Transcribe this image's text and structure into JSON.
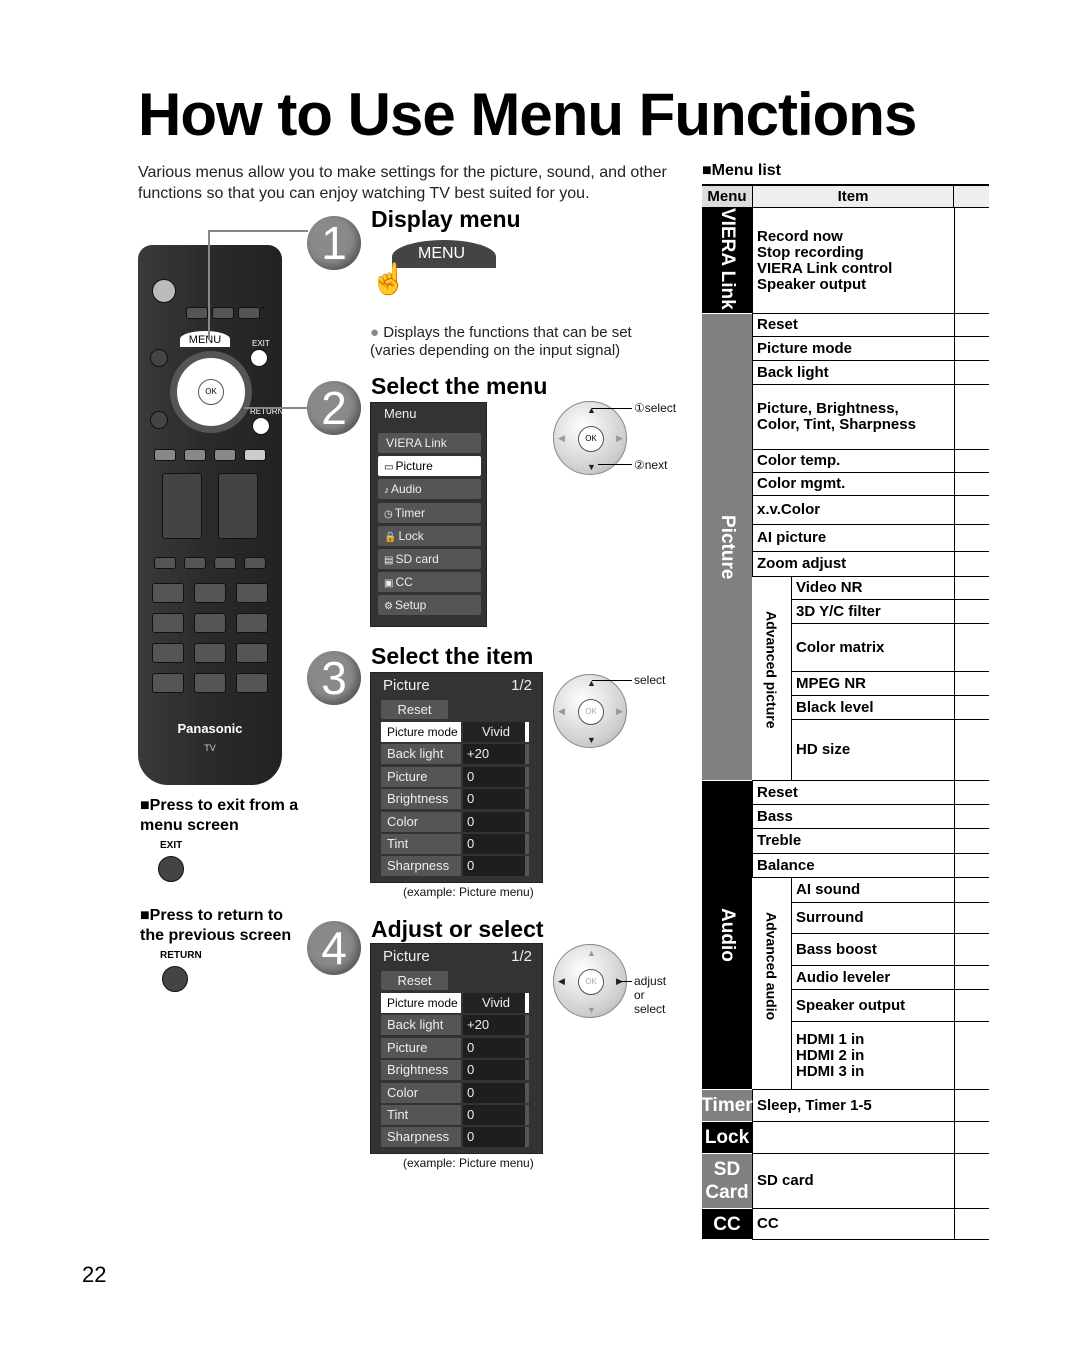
{
  "title": "How to Use Menu Functions",
  "intro": "Various menus allow you to make settings for the picture, sound, and other functions so that you can enjoy watching TV best suited for you.",
  "steps": [
    {
      "num": "1",
      "heading": "Display menu",
      "button_label": "MENU",
      "note": "Displays the functions that can be set (varies depending on the input signal)"
    },
    {
      "num": "2",
      "heading": "Select the menu",
      "dial_labels": [
        "①select",
        "②next"
      ]
    },
    {
      "num": "3",
      "heading": "Select the item",
      "dial_labels": [
        "select"
      ],
      "caption": "(example:  Picture menu)"
    },
    {
      "num": "4",
      "heading": "Adjust or select",
      "dial_labels": [
        "adjust",
        "or",
        "select"
      ],
      "caption": "(example:  Picture menu)"
    }
  ],
  "remote": {
    "menu": "MENU",
    "exit": "EXIT",
    "ok": "OK",
    "return": "RETURN",
    "brand": "Panasonic",
    "tv": "TV"
  },
  "side_notes": [
    {
      "text": "Press to exit from a menu screen",
      "button": "EXIT"
    },
    {
      "text": "Press to return to the previous screen",
      "button": "RETURN"
    }
  ],
  "menu_screen": {
    "title": "Menu",
    "items": [
      {
        "label": "VIERA Link",
        "icon": ""
      },
      {
        "label": "Picture",
        "icon": "▭",
        "selected": true
      },
      {
        "label": "Audio",
        "icon": "♪"
      },
      {
        "label": "Timer",
        "icon": "◷"
      },
      {
        "label": "Lock",
        "icon": "🔒"
      },
      {
        "label": "SD card",
        "icon": "▤"
      },
      {
        "label": "CC",
        "icon": "▣"
      },
      {
        "label": "Setup",
        "icon": "⚙"
      }
    ]
  },
  "picture_screen": {
    "title": "Picture",
    "page": "1/2",
    "reset": "Reset",
    "rows": [
      {
        "label": "Picture mode",
        "value": "Vivid",
        "selected": true
      },
      {
        "label": "Back light",
        "value": "+20"
      },
      {
        "label": "Picture",
        "value": "0"
      },
      {
        "label": "Brightness",
        "value": "0"
      },
      {
        "label": "Color",
        "value": "0"
      },
      {
        "label": "Tint",
        "value": "0"
      },
      {
        "label": "Sharpness",
        "value": "0"
      }
    ]
  },
  "menu_list": {
    "heading": "Menu list",
    "col_menu": "Menu",
    "col_item": "Item",
    "groups": [
      {
        "menu": "VIERA Link",
        "color": "#000000",
        "vertical": true,
        "items": [
          "Record now\nStop recording\nVIERA Link control\nSpeaker output"
        ]
      },
      {
        "menu": "Picture",
        "color": "#808080",
        "vertical": true,
        "items": [
          "Reset",
          "Picture mode",
          "Back light",
          "Picture, Brightness,\nColor, Tint, Sharpness",
          "Color temp.",
          "Color mgmt.",
          "x.v.Color",
          "AI picture",
          "Zoom adjust"
        ],
        "sub": {
          "label": "Advanced picture",
          "items": [
            "Video NR",
            "3D Y/C filter",
            "Color matrix",
            "MPEG NR",
            "Black level",
            "HD size"
          ]
        }
      },
      {
        "menu": "Audio",
        "color": "#000000",
        "vertical": true,
        "items": [
          "Reset",
          "Bass",
          "Treble",
          "Balance"
        ],
        "sub": {
          "label": "Advanced audio",
          "items": [
            "AI sound",
            "Surround",
            "Bass boost",
            "Audio leveler",
            "Speaker output",
            "HDMI 1 in\nHDMI 2 in\nHDMI 3 in"
          ]
        }
      },
      {
        "menu": "Timer",
        "color": "#808080",
        "items": [
          "Sleep, Timer 1-5"
        ]
      },
      {
        "menu": "Lock",
        "color": "#000000",
        "items": [
          ""
        ]
      },
      {
        "menu": "SD\nCard",
        "color": "#808080",
        "items": [
          "SD card"
        ]
      },
      {
        "menu": "CC",
        "color": "#000000",
        "items": [
          "CC"
        ]
      }
    ]
  },
  "page_number": "22"
}
